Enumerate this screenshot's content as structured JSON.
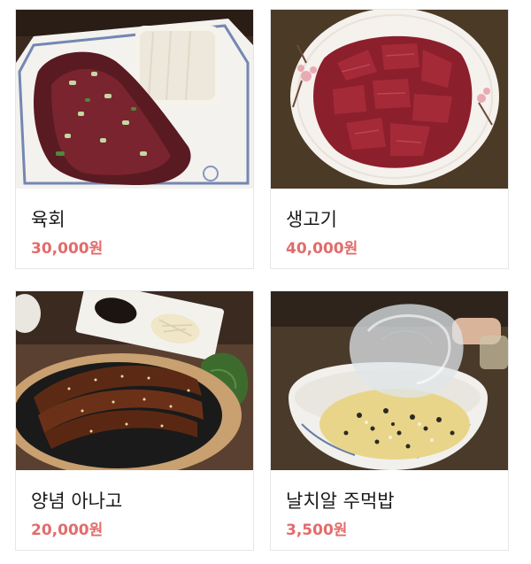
{
  "colors": {
    "price": "#e36b6b",
    "name": "#1a1a1a",
    "card_border": "#e6e6e6"
  },
  "menu": {
    "items": [
      {
        "name": "육회",
        "price": "30,000원",
        "photo": "yukhoe-photo"
      },
      {
        "name": "생고기",
        "price": "40,000원",
        "photo": "raw-beef-photo"
      },
      {
        "name": "양념 아나고",
        "price": "20,000원",
        "photo": "grilled-eel-photo"
      },
      {
        "name": "날치알 주먹밥",
        "price": "3,500원",
        "photo": "rice-ball-photo"
      }
    ]
  }
}
